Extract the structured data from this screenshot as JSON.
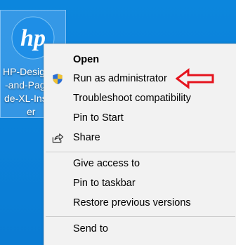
{
  "desktop": {
    "background_color": "#0a7fd6",
    "icon": {
      "icon_name": "hp-logo-icon",
      "label_lines": [
        "HP-Desig",
        "-and-Pag",
        "de-XL-Ins",
        "er"
      ]
    }
  },
  "context_menu": {
    "items": [
      {
        "label": "Open",
        "bold": true
      },
      {
        "label": "Run as administrator",
        "icon": "uac-shield-icon"
      },
      {
        "label": "Troubleshoot compatibility"
      },
      {
        "label": "Pin to Start"
      },
      {
        "label": "Share",
        "icon": "share-icon"
      },
      {
        "label": "Give access to"
      },
      {
        "label": "Pin to taskbar"
      },
      {
        "label": "Restore previous versions"
      },
      {
        "label": "Send to"
      }
    ]
  },
  "annotation": {
    "type": "arrow",
    "color": "#e5141e",
    "points_to": "Run as administrator"
  }
}
